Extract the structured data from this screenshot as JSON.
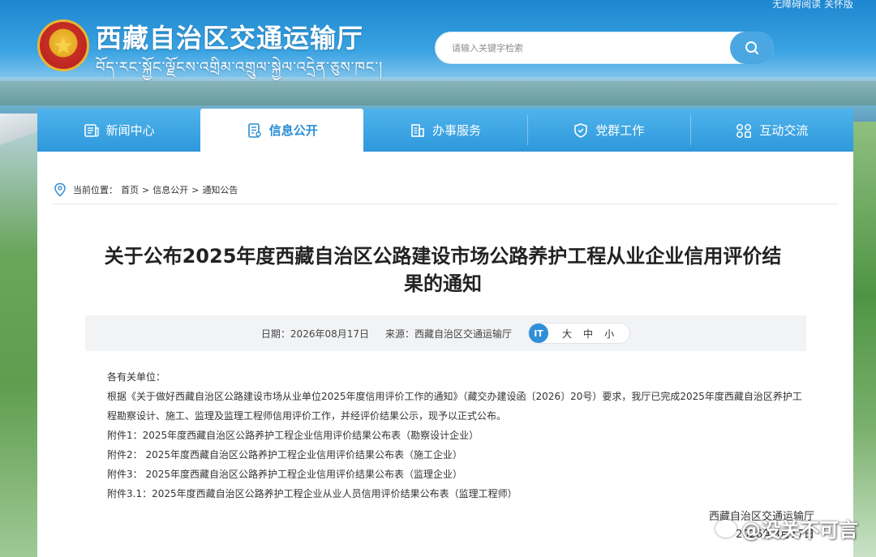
{
  "top_util": "无障碍阅读  关怀版",
  "header": {
    "title": "西藏自治区交通运输厅",
    "subtitle": "བོད་རང་སྐྱོང་ལྗོངས་འགྲིམ་འགྲུལ་སྐྱེལ་འདྲེན་ཅུས་ཁང་།",
    "search_placeholder": "请输入关键字检索"
  },
  "nav": {
    "items": [
      {
        "label": "新闻中心",
        "icon": "news-icon"
      },
      {
        "label": "信息公开",
        "icon": "info-doc-icon",
        "active": true
      },
      {
        "label": "办事服务",
        "icon": "building-icon"
      },
      {
        "label": "党群工作",
        "icon": "shield-icon"
      },
      {
        "label": "互动交流",
        "icon": "interaction-icon"
      }
    ]
  },
  "breadcrumb": {
    "prefix": "当前位置：",
    "items": [
      "首页",
      "信息公开",
      "通知公告"
    ],
    "separator": ">"
  },
  "article": {
    "title_line1": "关于公布2025年度西藏自治区公路建设市场公路养护工程从业企业信用评价结",
    "title_line2": "果的通知",
    "date_label": "日期：2026年08月17日",
    "source_label": "来源：西藏自治区交通运输厅",
    "font_size_icon": "IT",
    "font_sizes": [
      "大",
      "中",
      "小"
    ],
    "salutation": "各有关单位：",
    "paragraph": "根据《关于做好西藏自治区公路建设市场从业单位2025年度信用评价工作的通知》（藏交办建设函〔2026〕20号）要求，我厅已完成2025年度西藏自治区养护工程勘察设计、施工、监理及监理工程师信用评价工作，并经评价结果公示，现予以正式公布。",
    "attachments": [
      "附件1：2025年度西藏自治区公路养护工程企业信用评价结果公布表（勘察设计企业）",
      "附件2：  2025年度西藏自治区公路养护工程企业信用评价结果公布表（施工企业）",
      "附件3：  2025年度西藏自治区公路养护工程企业信用评价结果公布表（监理企业）",
      "附件3.1：2025年度西藏自治区公路养护工程企业从业人员信用评价结果公布表（监理工程师）"
    ],
    "sign_org": "西藏自治区交通运输厅",
    "sign_date": "2026年8月17日"
  },
  "watermark": "@没关不可言",
  "colors": {
    "nav_blue": "#2e98db",
    "active_text": "#2a8fd6",
    "meta_bg": "#f2f3f5"
  }
}
